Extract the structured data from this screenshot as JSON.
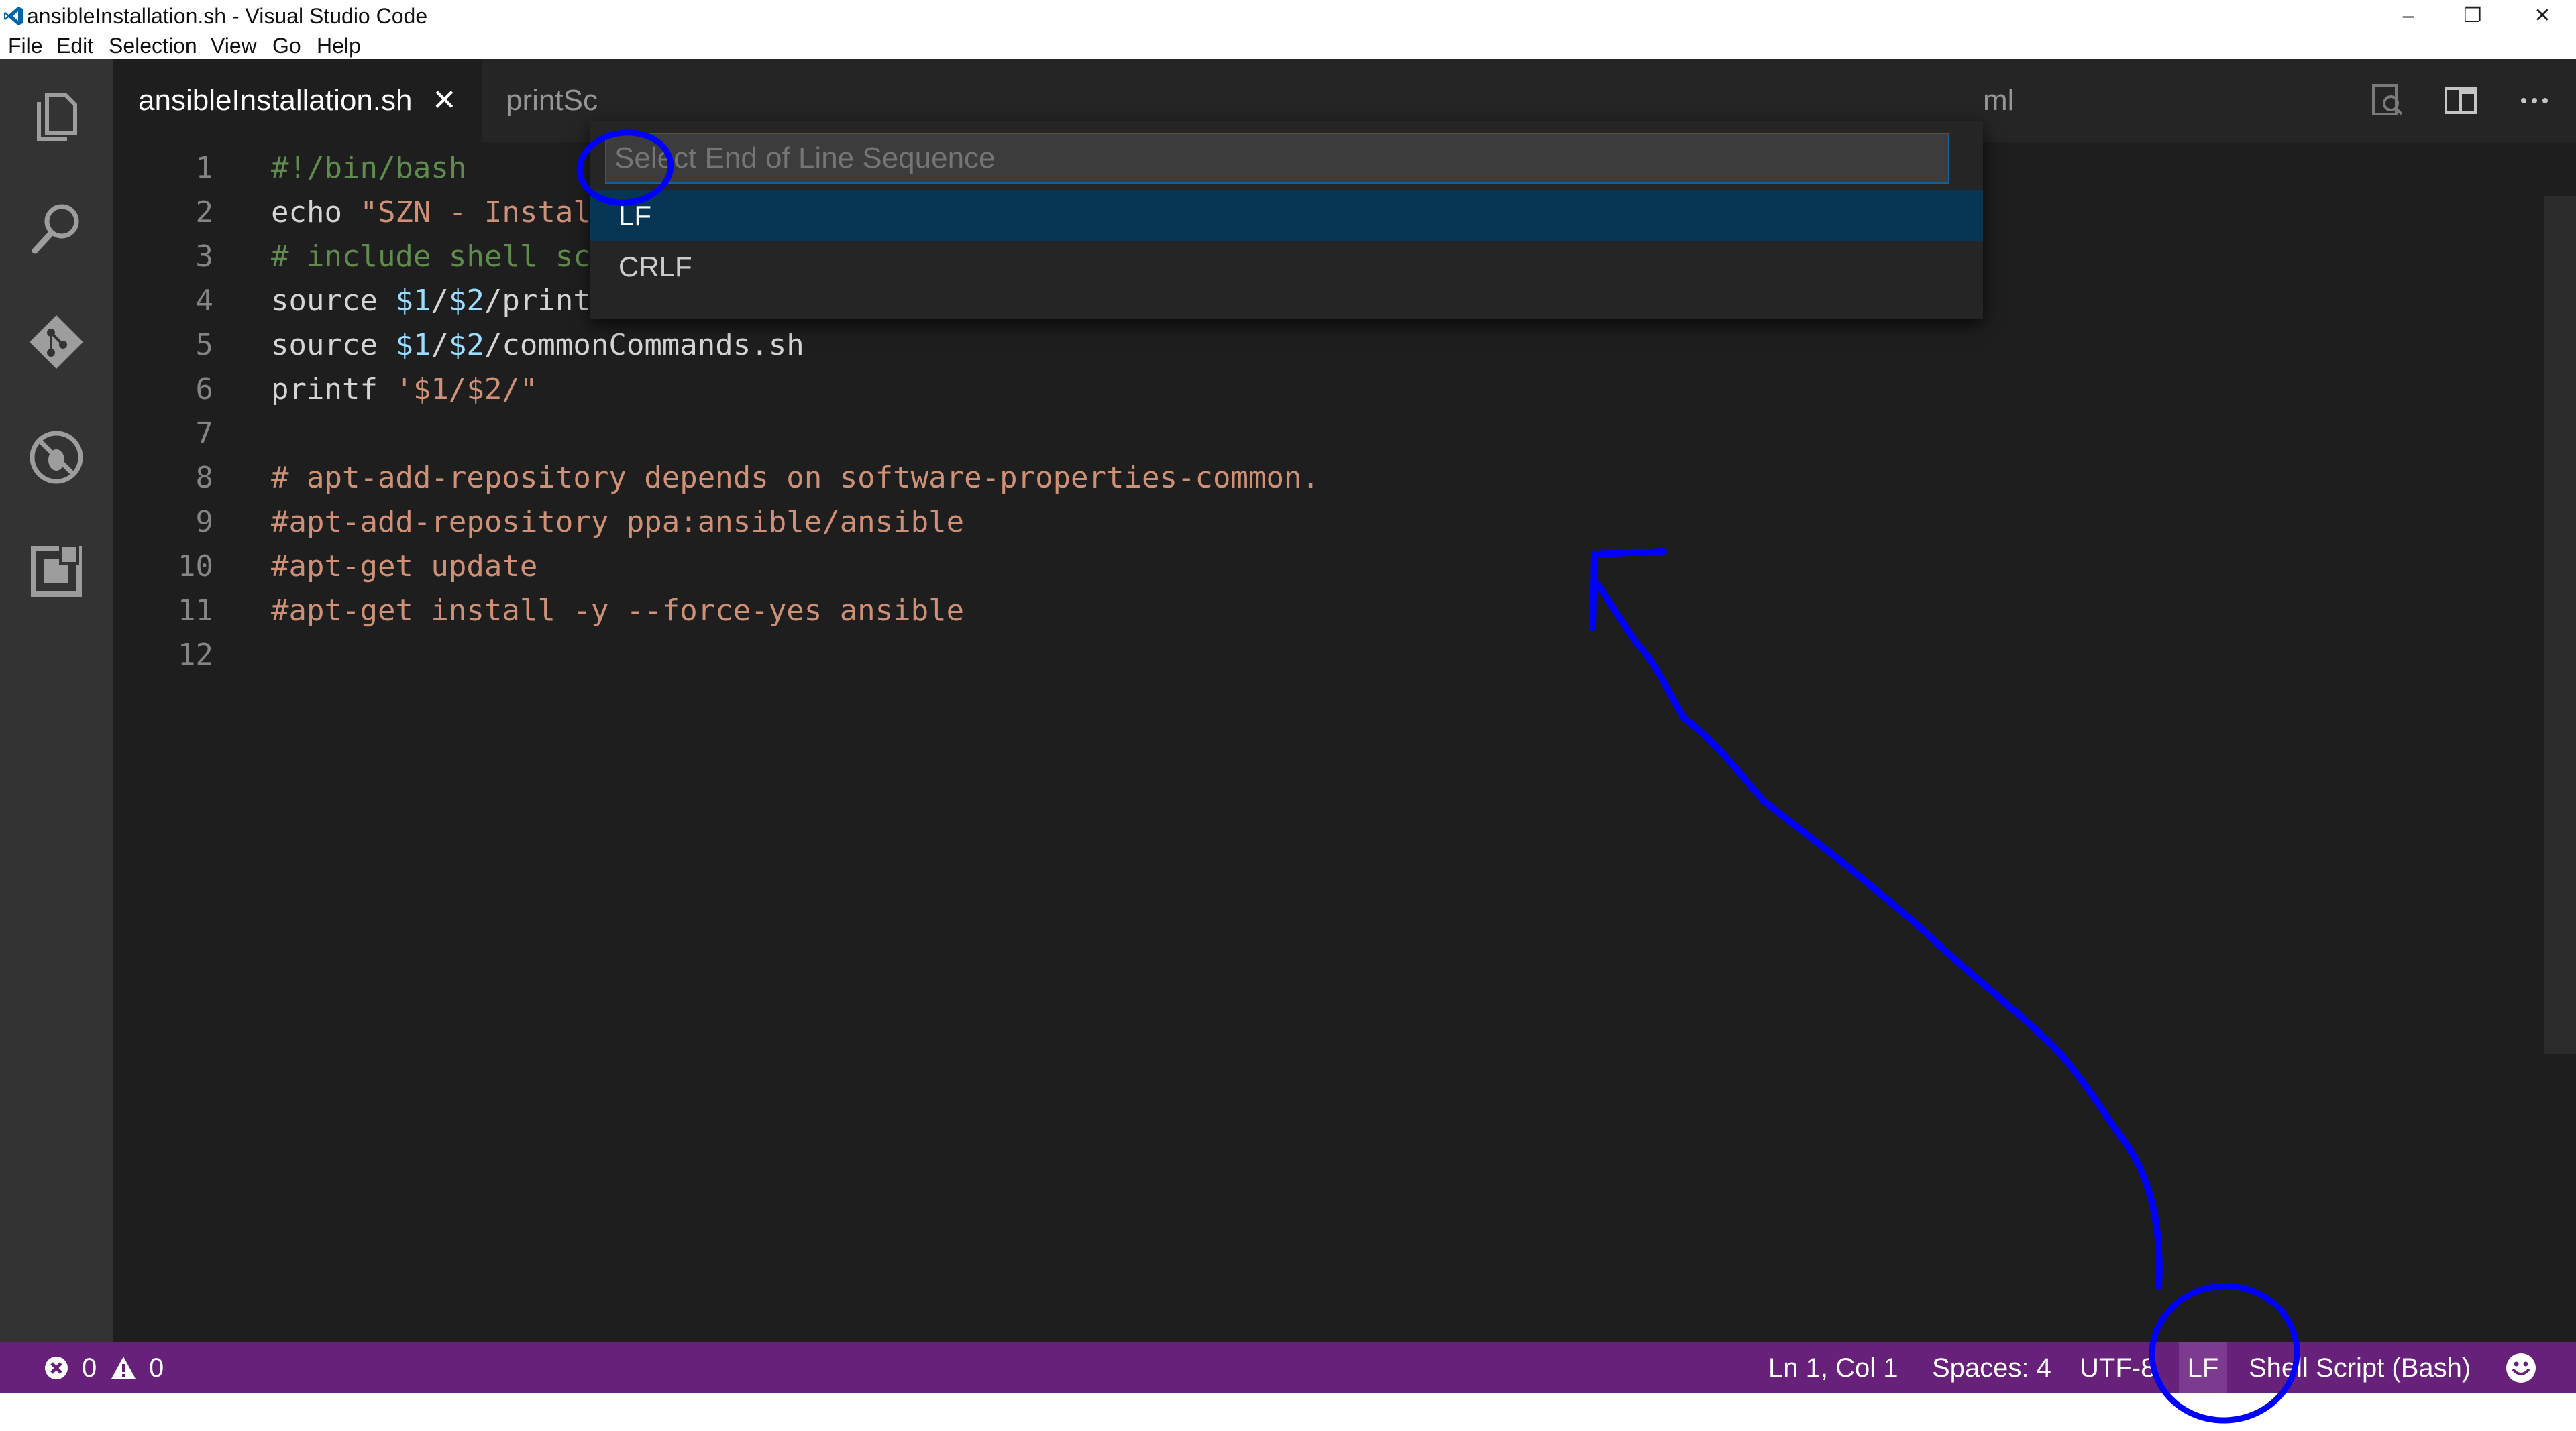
{
  "window": {
    "title": "ansibleInstallation.sh - Visual Studio Code",
    "controls": {
      "minimize": "–",
      "restore": "❐",
      "close": "✕"
    }
  },
  "menu": [
    "File",
    "Edit",
    "Selection",
    "View",
    "Go",
    "Help"
  ],
  "activity_bar": {
    "icons": [
      "files-icon",
      "search-icon",
      "git-icon",
      "debug-icon",
      "extensions-icon"
    ]
  },
  "tabs": [
    {
      "label": "ansibleInstallation.sh",
      "active": true,
      "close": "✕"
    },
    {
      "label": "printSc",
      "active": false
    },
    {
      "label": "ml",
      "active": false
    }
  ],
  "quick_pick": {
    "placeholder": "Select End of Line Sequence",
    "items": [
      "LF",
      "CRLF"
    ],
    "selected": "LF"
  },
  "editor": {
    "line_numbers": [
      "1",
      "2",
      "3",
      "4",
      "5",
      "6",
      "7",
      "8",
      "9",
      "10",
      "11",
      "12"
    ],
    "lines": [
      [
        {
          "t": "#!/bin/bash",
          "c": "comment"
        }
      ],
      [
        {
          "t": "echo ",
          "c": "plain"
        },
        {
          "t": "\"SZN - Instal",
          "c": "string"
        }
      ],
      [
        {
          "t": "# include shell sc",
          "c": "comment"
        }
      ],
      [
        {
          "t": "source ",
          "c": "plain"
        },
        {
          "t": "$1",
          "c": "var"
        },
        {
          "t": "/",
          "c": "plain"
        },
        {
          "t": "$2",
          "c": "var"
        },
        {
          "t": "/printScriptPath.sh",
          "c": "plain"
        }
      ],
      [
        {
          "t": "source ",
          "c": "plain"
        },
        {
          "t": "$1",
          "c": "var"
        },
        {
          "t": "/",
          "c": "plain"
        },
        {
          "t": "$2",
          "c": "var"
        },
        {
          "t": "/commonCommands.sh",
          "c": "plain"
        }
      ],
      [
        {
          "t": "printf ",
          "c": "plain"
        },
        {
          "t": "'$1/$2/\"",
          "c": "string"
        }
      ],
      [],
      [
        {
          "t": "# apt-add-repository depends on software-properties-common.",
          "c": "string"
        }
      ],
      [
        {
          "t": "#apt-add-repository ppa:ansible/ansible",
          "c": "string"
        }
      ],
      [
        {
          "t": "#apt-get update",
          "c": "string"
        }
      ],
      [
        {
          "t": "#apt-get install -y --force-yes ansible",
          "c": "string"
        }
      ],
      []
    ]
  },
  "status_bar": {
    "errors": "0",
    "warnings": "0",
    "position": "Ln 1, Col 1",
    "spaces": "Spaces: 4",
    "encoding": "UTF-8",
    "eol": "LF",
    "language": "Shell Script (Bash)",
    "feedback_icon": "smiley-icon"
  },
  "colors": {
    "statusbar": "#68217a",
    "editor_bg": "#1e1e1e",
    "annotation": "#0000ff"
  }
}
